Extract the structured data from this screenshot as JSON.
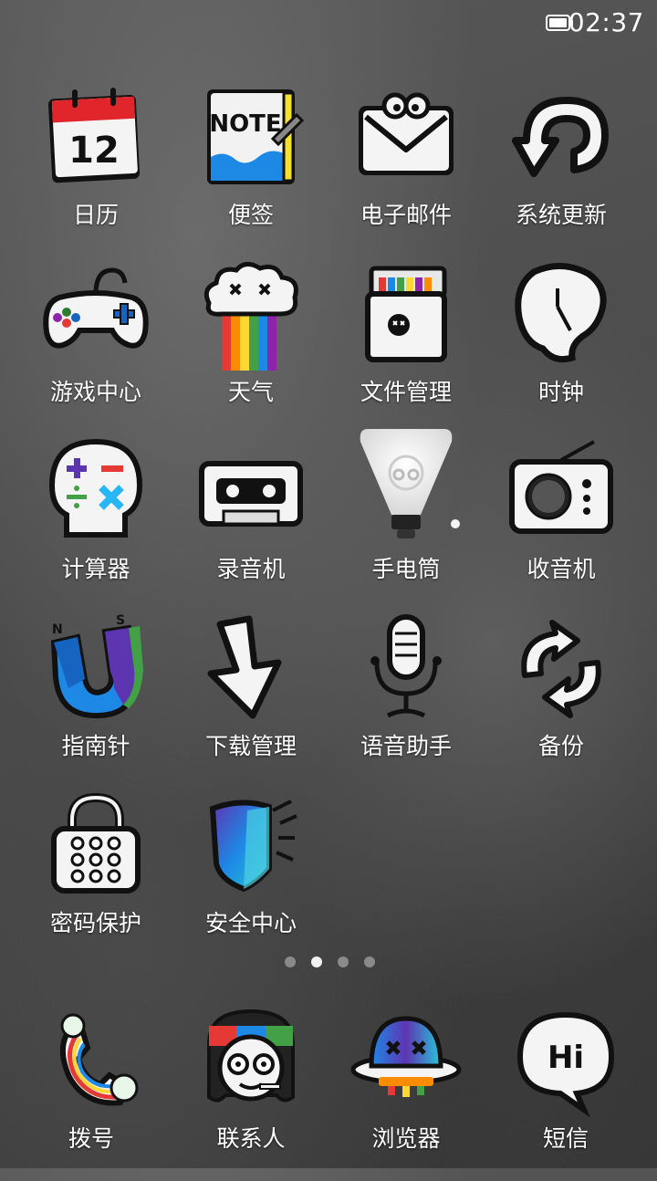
{
  "status_bar": {
    "time": "02:37",
    "battery_icon": "battery-full-icon"
  },
  "apps": [
    {
      "label": "日历",
      "icon": "calendar-icon"
    },
    {
      "label": "便签",
      "icon": "note-icon",
      "icon_text": "NOTE"
    },
    {
      "label": "电子邮件",
      "icon": "email-icon"
    },
    {
      "label": "系统更新",
      "icon": "update-arrow-icon"
    },
    {
      "label": "游戏中心",
      "icon": "gamepad-icon"
    },
    {
      "label": "天气",
      "icon": "rainbow-cloud-icon"
    },
    {
      "label": "文件管理",
      "icon": "file-box-icon"
    },
    {
      "label": "时钟",
      "icon": "melting-clock-icon"
    },
    {
      "label": "计算器",
      "icon": "calculator-skull-icon"
    },
    {
      "label": "录音机",
      "icon": "cassette-icon"
    },
    {
      "label": "手电筒",
      "icon": "flashlight-bulb-icon"
    },
    {
      "label": "收音机",
      "icon": "radio-icon"
    },
    {
      "label": "指南针",
      "icon": "magnet-icon"
    },
    {
      "label": "下载管理",
      "icon": "download-arrow-icon"
    },
    {
      "label": "语音助手",
      "icon": "microphone-icon"
    },
    {
      "label": "备份",
      "icon": "sync-arrows-icon"
    },
    {
      "label": "密码保护",
      "icon": "padlock-icon"
    },
    {
      "label": "安全中心",
      "icon": "shield-icon"
    }
  ],
  "calendar_day": "12",
  "dock": [
    {
      "label": "拨号",
      "icon": "phone-icon"
    },
    {
      "label": "联系人",
      "icon": "contact-face-icon"
    },
    {
      "label": "浏览器",
      "icon": "planet-browser-icon"
    },
    {
      "label": "短信",
      "icon": "speech-bubble-icon",
      "icon_text": "Hi"
    }
  ],
  "page_indicator": {
    "total": 4,
    "current": 2
  }
}
